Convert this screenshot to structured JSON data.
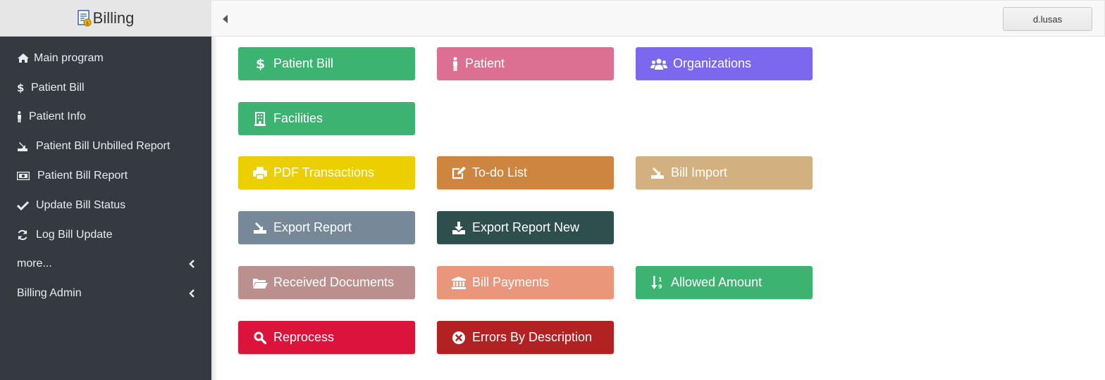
{
  "app": {
    "title": "Billing"
  },
  "sidebar": {
    "items": [
      {
        "label": "Main program",
        "icon": "home-icon"
      },
      {
        "label": "Patient Bill",
        "icon": "dollar-icon"
      },
      {
        "label": "Patient Info",
        "icon": "person-icon"
      },
      {
        "label": "Patient Bill Unbilled Report",
        "icon": "export-icon"
      },
      {
        "label": "Patient Bill Report",
        "icon": "money-bill-icon"
      },
      {
        "label": "Update Bill Status",
        "icon": "check-icon"
      },
      {
        "label": "Log Bill Update",
        "icon": "refresh-icon"
      },
      {
        "label": "more...",
        "icon": "chevron-left-icon"
      },
      {
        "label": "Billing Admin",
        "icon": "chevron-left-icon"
      }
    ]
  },
  "header": {
    "user": "d.lusas"
  },
  "tiles": [
    {
      "label": "Patient Bill",
      "color": "#3cb371",
      "icon": "dollar-icon"
    },
    {
      "label": "Patient",
      "color": "#db7093",
      "icon": "person-icon"
    },
    {
      "label": "Organizations",
      "color": "#7b68ee",
      "icon": "users-icon"
    },
    {
      "label": "Facilities",
      "color": "#3cb371",
      "icon": "building-icon"
    },
    {
      "label": "PDF Transactions",
      "color": "#eccf00",
      "icon": "print-icon"
    },
    {
      "label": "To-do List",
      "color": "#cd853f",
      "icon": "edit-icon"
    },
    {
      "label": "Bill Import",
      "color": "#d2b07f",
      "icon": "import-icon"
    },
    {
      "label": "Export Report",
      "color": "#778899",
      "icon": "export-icon"
    },
    {
      "label": "Export Report New",
      "color": "#2f4f4f",
      "icon": "download-icon"
    },
    {
      "label": "Received Documents",
      "color": "#bc8f8f",
      "icon": "folder-open-icon"
    },
    {
      "label": "Bill Payments",
      "color": "#e9967a",
      "icon": "bank-icon"
    },
    {
      "label": "Allowed Amount",
      "color": "#3cb371",
      "icon": "sort-numeric-icon"
    },
    {
      "label": "Reprocess",
      "color": "#dc143c",
      "icon": "search-icon"
    },
    {
      "label": "Errors By Description",
      "color": "#b22222",
      "icon": "times-circle-icon"
    }
  ]
}
